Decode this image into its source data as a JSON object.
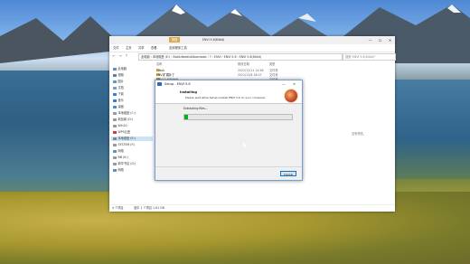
{
  "explorer": {
    "active_tab": "管理",
    "window_title": "ENVI 5.6(64bit)",
    "ribbon": [
      "文件",
      "主页",
      "共享",
      "查看",
      "应用程序工具"
    ],
    "address_path": "此电脑 › 本地磁盘 (E:) › BaiduNetdiskDownload › 7 › ENVI › ENVI 5.6 › ENVI 5.6(64bit)",
    "search_placeholder": "搜索\"ENVI 5.6(64bit)\"",
    "columns": {
      "name": "名称",
      "date": "修改日期",
      "type": "类型"
    },
    "sidebar": [
      {
        "label": "此电脑"
      },
      {
        "label": "视频"
      },
      {
        "label": "图片"
      },
      {
        "label": "文档"
      },
      {
        "label": "下载"
      },
      {
        "label": "音乐"
      },
      {
        "label": "桌面"
      },
      {
        "label": "本地磁盘 (C:)"
      },
      {
        "label": "新加卷 (D:)"
      },
      {
        "label": "Win10"
      },
      {
        "label": "WPS云盘"
      },
      {
        "label": "本地磁盘 (E:)"
      },
      {
        "label": "SYSTEM (F:)"
      },
      {
        "label": "网络"
      },
      {
        "label": "BN (K:)"
      },
      {
        "label": "新华书店 (G:)"
      },
      {
        "label": "网络"
      }
    ],
    "files": [
      {
        "name": "Crack",
        "date": "2022/12/11 14:58",
        "type": "文件夹"
      },
      {
        "name": "ENVI扩展补丁",
        "date": "2022/12/8 18:07",
        "type": "文件夹"
      },
      {
        "name": "ENVI 5.6(64bit)",
        "date": "",
        "type": "文件夹"
      },
      {
        "name": "envi56",
        "date": "",
        "type": "应用程序"
      },
      {
        "name": "重要说明",
        "date": "",
        "type": "文本文档"
      }
    ],
    "empty_message": "没有预览。",
    "status": {
      "count": "4 个项目",
      "selected": "选中 1 个项目",
      "size": "1.61 GB"
    },
    "win_controls": [
      "—",
      "☐",
      "✕"
    ]
  },
  "setup": {
    "title": "Setup - ENVI 5.6",
    "heading": "Installing",
    "subheading": "Please wait while Setup installs ENVI 5.6 on your computer.",
    "extract_label": "Extracting files...",
    "progress": 0.03,
    "cancel_label": "Cancel",
    "minimize": "—",
    "close": "✕"
  }
}
